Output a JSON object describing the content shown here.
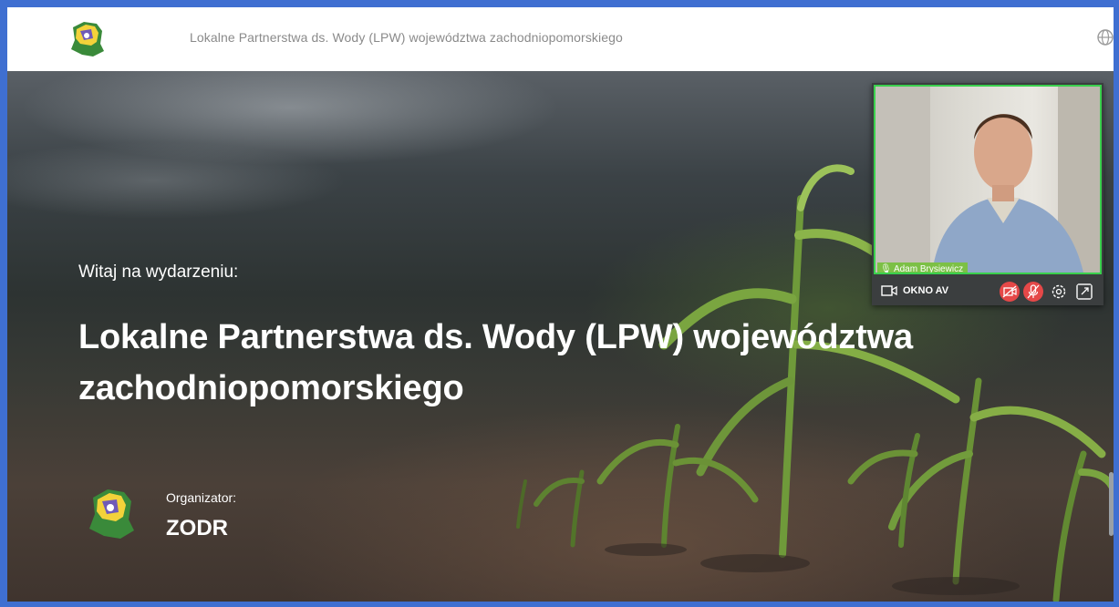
{
  "header": {
    "title": "Lokalne Partnerstwa ds. Wody (LPW) województwa zachodniopomorskiego",
    "logo_icon": "zodr-logo-icon",
    "language_icon": "globe-icon"
  },
  "hero": {
    "welcome": "Witaj na wydarzeniu:",
    "title": "Lokalne Partnerstwa ds. Wody (LPW) województwa zachodniopomorskiego",
    "organizer_label": "Organizator:",
    "organizer_name": "ZODR"
  },
  "av_window": {
    "speaker_name": "Adam Brysiewicz",
    "label": "OKNO AV",
    "controls": [
      "camera-off-icon",
      "mic-off-icon",
      "gear-icon",
      "expand-icon"
    ]
  },
  "colors": {
    "frame_border": "#3f6fd1",
    "active_speaker": "#3ad04d",
    "danger": "#e54848",
    "speaker_tag": "#7cc046"
  }
}
